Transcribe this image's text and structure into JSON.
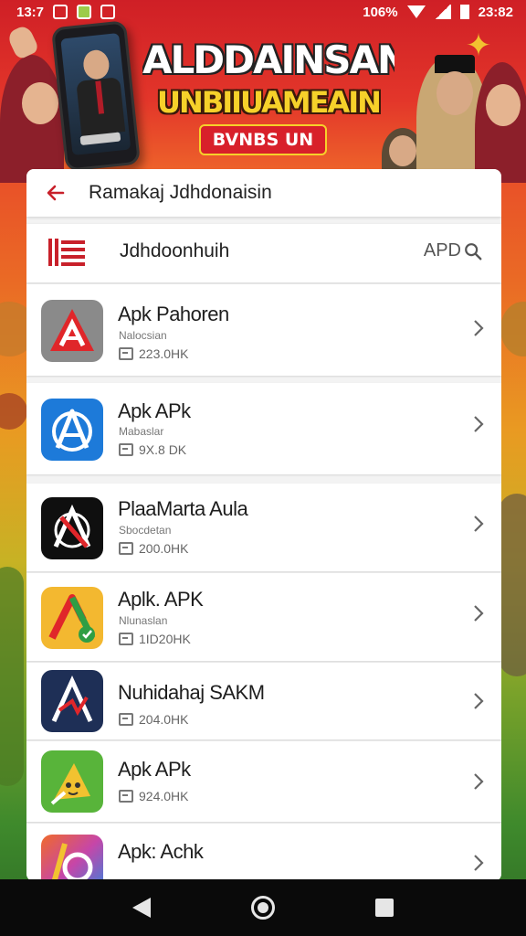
{
  "status_bar": {
    "time": "13:7",
    "battery": "106%",
    "clock": "23:82"
  },
  "banner": {
    "title_line1": "ALDDAINSAN",
    "title_line2": "UNBIIUAMEAIN",
    "button_label": "BVNBS UN"
  },
  "header": {
    "title": "Ramakaj Jdhdonaisin"
  },
  "search": {
    "title": "Jdhdoonhuih",
    "action_label": "APD"
  },
  "apps": [
    {
      "name": "Apk Pahoren",
      "subtitle": "Nalocsian",
      "size": "223.0HK",
      "icon": "red-a-icon",
      "colors": {
        "bg": "#8a8a8a",
        "fg": "#e0262a"
      }
    },
    {
      "name": "Apk APk",
      "subtitle": "Mabaslar",
      "size": "9X.8 DK",
      "icon": "blue-a-icon",
      "colors": {
        "bg": "#1d7ad9",
        "fg": "#ffffff"
      }
    },
    {
      "name": "PlaaMarta Aula",
      "subtitle": "Sbocdetan",
      "size": "200.0HK",
      "icon": "black-a-icon",
      "colors": {
        "bg": "#0f0f0f",
        "fg": "#e0262a"
      }
    },
    {
      "name": "Aplk. APK",
      "subtitle": "Nlunaslan",
      "size": "1ID20HK",
      "icon": "yellow-a-icon",
      "colors": {
        "bg": "#f3b830",
        "fg": "#e0262a"
      }
    },
    {
      "name": "Nuhidahaj SAKM",
      "subtitle": "",
      "size": "204.0HK",
      "icon": "navy-a-icon",
      "colors": {
        "bg": "#1e2f56",
        "fg": "#ffffff"
      }
    },
    {
      "name": "Apk APk",
      "subtitle": "",
      "size": "924.0HK",
      "icon": "green-a-icon",
      "colors": {
        "bg": "#58b43a",
        "fg": "#f2c230"
      }
    },
    {
      "name": "Apk: Achk",
      "subtitle": "",
      "size": "",
      "icon": "gradient-a-icon",
      "colors": {
        "bg": "#2f86e0",
        "fg": "#ffffff"
      }
    }
  ]
}
